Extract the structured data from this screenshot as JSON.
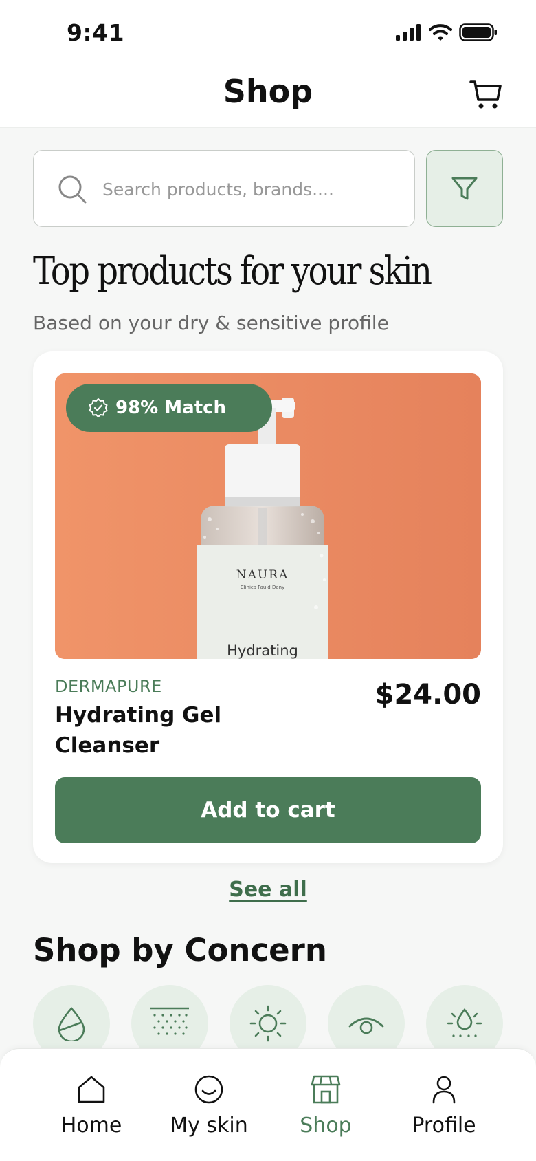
{
  "status_bar": {
    "time": "9:41"
  },
  "header": {
    "title": "Shop",
    "cart_icon": "cart-icon"
  },
  "search": {
    "placeholder": "Search products, brands....",
    "value": ""
  },
  "filter": {
    "icon": "filter-icon"
  },
  "recommendations": {
    "title": "Top products for your skin",
    "subtitle": "Based on your dry & sensitive profile",
    "product": {
      "match_badge": "98% Match",
      "brand": "DERMAPURE",
      "name": "Hydrating Gel Cleanser",
      "price": "$24.00",
      "add_to_cart_label": "Add to cart",
      "image_label_brand": "NAURA",
      "image_label_sub": "Clinica Fauid Dany",
      "image_label_text": "Hydrating"
    },
    "see_all_label": "See all"
  },
  "concerns": {
    "title": "Shop by Concern",
    "items": [
      {
        "icon": "droplet-icon"
      },
      {
        "icon": "texture-icon"
      },
      {
        "icon": "sun-icon"
      },
      {
        "icon": "eye-icon"
      },
      {
        "icon": "sun-droplet-icon"
      }
    ]
  },
  "tab_bar": {
    "tabs": [
      {
        "label": "Home",
        "icon": "home-icon"
      },
      {
        "label": "My skin",
        "icon": "smiley-icon"
      },
      {
        "label": "Shop",
        "icon": "store-icon",
        "active": true
      },
      {
        "label": "Profile",
        "icon": "user-icon"
      }
    ]
  },
  "colors": {
    "accent": "#4b7c59",
    "accent_light": "#e6efe7",
    "background": "#f6f7f6",
    "product_bg": "#ec8c65"
  }
}
